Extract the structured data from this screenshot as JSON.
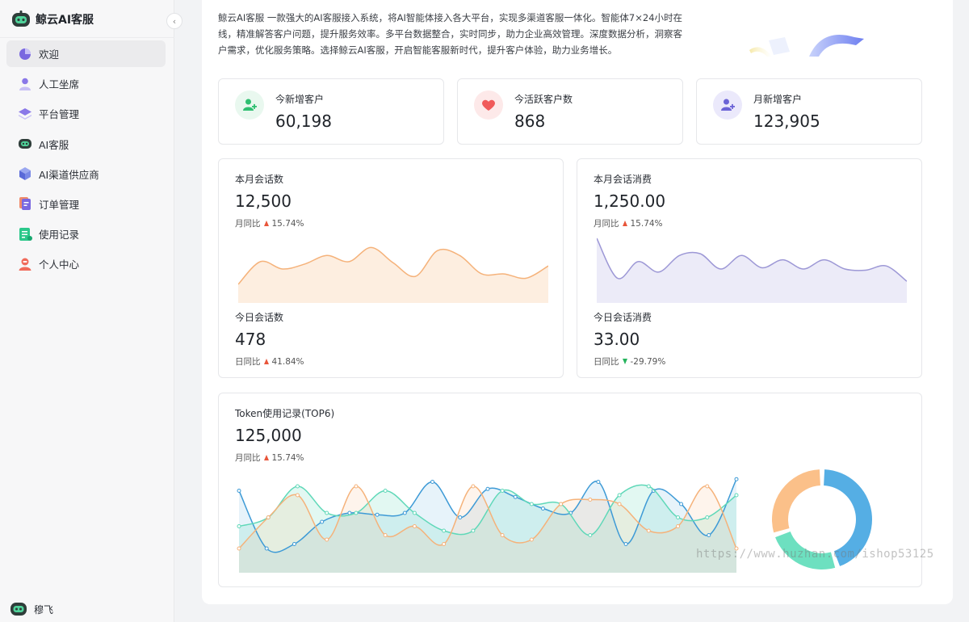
{
  "sidebar": {
    "brand": "鲸云AI客服",
    "items": [
      {
        "label": "欢迎",
        "active": true
      },
      {
        "label": "人工坐席"
      },
      {
        "label": "平台管理"
      },
      {
        "label": "AI客服"
      },
      {
        "label": "AI渠道供应商"
      },
      {
        "label": "订单管理"
      },
      {
        "label": "使用记录"
      },
      {
        "label": "个人中心"
      }
    ],
    "user_name": "穆飞"
  },
  "intro": {
    "text": "鲸云AI客服 一款强大的AI客服接入系统，将AI智能体接入各大平台，实现多渠道客服一体化。智能体7×24小时在线，精准解答客户问题，提升服务效率。多平台数据整合，实时同步，助力企业高效管理。深度数据分析，洞察客户需求，优化服务策略。选择鲸云AI客服，开启智能客服新时代，提升客户体验，助力业务增长。"
  },
  "stats": [
    {
      "label": "今新增客户",
      "value": "60,198",
      "color": "#2fbf71",
      "bg": "#e9f8ef",
      "icon": "add-user-icon"
    },
    {
      "label": "今活跃客户数",
      "value": "868",
      "color": "#f05a5a",
      "bg": "#fde9e9",
      "icon": "heart-icon"
    },
    {
      "label": "月新增客户",
      "value": "123,905",
      "color": "#6b63d6",
      "bg": "#ebe9fb",
      "icon": "add-user-icon"
    }
  ],
  "sessions": {
    "month_label": "本月会话数",
    "month_value": "12,500",
    "month_compare_label": "月同比",
    "month_compare": "15.74%",
    "today_label": "今日会话数",
    "today_value": "478",
    "today_compare_label": "日同比",
    "today_compare": "41.84%"
  },
  "consumption": {
    "month_label": "本月会话消费",
    "month_value": "1,250.00",
    "month_compare_label": "月同比",
    "month_compare": "15.74%",
    "today_label": "今日会话消费",
    "today_value": "33.00",
    "today_compare_label": "日同比",
    "today_compare": "-29.79%"
  },
  "token": {
    "title": "Token使用记录(TOP6)",
    "value": "125,000",
    "compare_label": "月同比",
    "compare": "15.74%"
  },
  "watermark": "https://www.huzhan.com/ishop53125",
  "colors": {
    "orange": "#f5b27a",
    "purple": "#9d98d6",
    "blue": "#3d9ad6",
    "green": "#5fd8b8",
    "red_up": "#e8553a",
    "green_down": "#26b45d"
  },
  "chart_data": [
    {
      "type": "area",
      "series": [
        {
          "values": [
            0.25,
            0.62,
            0.5,
            0.58,
            0.72,
            0.62,
            0.85,
            0.6,
            0.38,
            0.8,
            0.72,
            0.42,
            0.42,
            0.35,
            0.55
          ]
        }
      ],
      "ylim": [
        0,
        1
      ]
    },
    {
      "type": "area",
      "series": [
        {
          "values": [
            1.0,
            0.35,
            0.62,
            0.45,
            0.72,
            0.75,
            0.5,
            0.72,
            0.52,
            0.65,
            0.5,
            0.65,
            0.5,
            0.48,
            0.55,
            0.3
          ]
        }
      ],
      "ylim": [
        0,
        1
      ]
    },
    {
      "type": "line",
      "series": [
        {
          "values": [
            0.85,
            0.2,
            0.25,
            0.5,
            0.6,
            0.58,
            0.6,
            0.95,
            0.55,
            0.87,
            0.78,
            0.65,
            0.6,
            0.95,
            0.25,
            0.85,
            0.7,
            0.35,
            0.98
          ]
        },
        {
          "values": [
            0.45,
            0.55,
            0.9,
            0.6,
            0.6,
            0.85,
            0.6,
            0.4,
            0.4,
            0.85,
            0.7,
            0.7,
            0.35,
            0.8,
            0.9,
            0.55,
            0.55,
            0.8
          ]
        },
        {
          "values": [
            0.2,
            0.55,
            0.8,
            0.3,
            0.9,
            0.35,
            0.45,
            0.25,
            0.9,
            0.35,
            0.3,
            0.7,
            0.75,
            0.7,
            0.4,
            0.45,
            0.9,
            0.2
          ]
        }
      ],
      "ylim": [
        0,
        1
      ]
    },
    {
      "type": "pie",
      "values": [
        45,
        25,
        30
      ],
      "colors": [
        "#55aee4",
        "#6de0c0",
        "#fbc089"
      ]
    }
  ]
}
